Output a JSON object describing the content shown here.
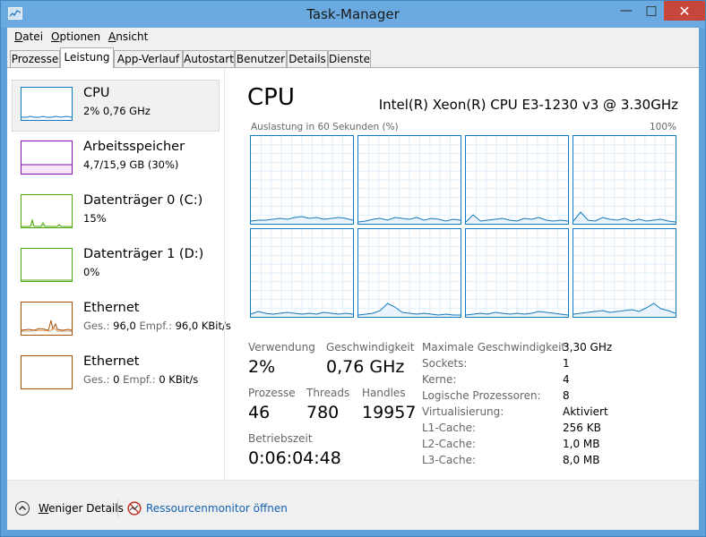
{
  "window": {
    "title": "Task-Manager",
    "controls": {
      "minimize": "—",
      "maximize": "□",
      "close": "✕"
    }
  },
  "menu": [
    {
      "hot": "D",
      "rest": "atei"
    },
    {
      "hot": "O",
      "rest": "ptionen"
    },
    {
      "hot": "A",
      "rest": "nsicht"
    }
  ],
  "tabs": [
    "Prozesse",
    "Leistung",
    "App-Verlauf",
    "Autostart",
    "Benutzer",
    "Details",
    "Dienste"
  ],
  "active_tab": "Leistung",
  "resources": [
    {
      "name": "CPU",
      "value": "2% 0,76 GHz",
      "color": "#1179c1",
      "icon": "cpu-mini-graph",
      "selected": true
    },
    {
      "name": "Arbeitsspeicher",
      "value": "4,7/15,9 GB (30%)",
      "color": "#8b12ae",
      "icon": "memory-mini-graph"
    },
    {
      "name": "Datenträger 0 (C:)",
      "value": "15%",
      "color": "#4da60c",
      "icon": "disk-mini-graph"
    },
    {
      "name": "Datenträger 1 (D:)",
      "value": "0%",
      "color": "#4da60c",
      "icon": "disk-mini-graph"
    },
    {
      "name": "Ethernet",
      "send_label": "Ges.:",
      "send_value": "96,0",
      "recv_label": "Empf.:",
      "recv_value": "96,0 KBit/s",
      "color": "#a74f01",
      "icon": "ethernet-mini-graph"
    },
    {
      "name": "Ethernet",
      "send_label": "Ges.:",
      "send_value": "0",
      "recv_label": "Empf.:",
      "recv_value": "0 KBit/s",
      "color": "#a74f01",
      "icon": "ethernet-mini-graph"
    }
  ],
  "detail": {
    "title": "CPU",
    "model": "Intel(R) Xeon(R) CPU E3-1230 v3 @ 3.30GHz",
    "graph_label": "Auslastung in 60 Sekunden (%)",
    "graph_max": "100%",
    "core_count_shown": 8,
    "accent": "#1179c1",
    "stats": {
      "usage_label": "Verwendung",
      "usage_value": "2%",
      "speed_label": "Geschwindigkeit",
      "speed_value": "0,76 GHz",
      "processes_label": "Prozesse",
      "processes_value": "46",
      "threads_label": "Threads",
      "threads_value": "780",
      "handles_label": "Handles",
      "handles_value": "19957",
      "uptime_label": "Betriebszeit",
      "uptime_value": "0:06:04:48"
    },
    "info": [
      {
        "label": "Maximale Geschwindigkeit:",
        "value": "3,30 GHz"
      },
      {
        "label": "Sockets:",
        "value": "1"
      },
      {
        "label": "Kerne:",
        "value": "4"
      },
      {
        "label": "Logische Prozessoren:",
        "value": "8"
      },
      {
        "label": "Virtualisierung:",
        "value": "Aktiviert"
      },
      {
        "label": "L1-Cache:",
        "value": "256 KB"
      },
      {
        "label": "L2-Cache:",
        "value": "1,0 MB"
      },
      {
        "label": "L3-Cache:",
        "value": "8,0 MB"
      }
    ]
  },
  "footer": {
    "less_details_hot": "W",
    "less_details_rest": "eniger Details",
    "resource_monitor": "Ressourcenmonitor öffnen"
  }
}
